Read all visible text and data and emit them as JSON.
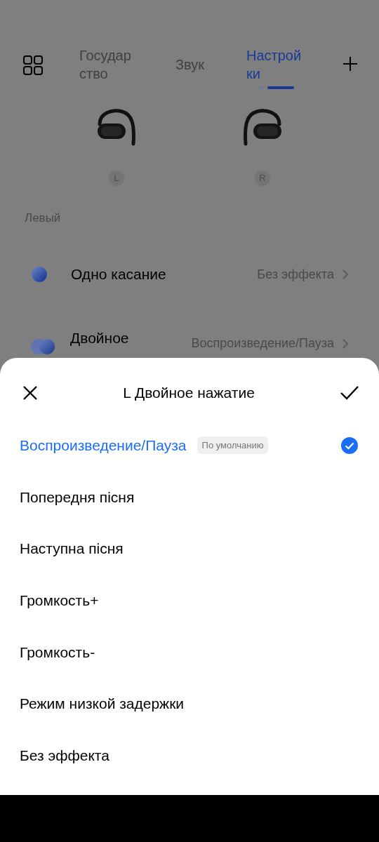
{
  "header": {
    "tabs": [
      {
        "label": "Государ\nство",
        "selected": false
      },
      {
        "label": "Звук",
        "selected": false
      },
      {
        "label": "Настрой\nки",
        "selected": true
      }
    ]
  },
  "earbuds": [
    {
      "side": "L"
    },
    {
      "side": "R"
    }
  ],
  "section_title": "Левый",
  "gestures": [
    {
      "kind": "single",
      "label": "Одно касание",
      "value": "Без эффекта"
    },
    {
      "kind": "double",
      "label": "Двойное",
      "value": "Воспроизведение/Пауза"
    }
  ],
  "sheet": {
    "title": "L Двойное нажатие",
    "options": [
      {
        "label": "Воспроизведение/Пауза",
        "selected": true,
        "badge": "По умолчанию"
      },
      {
        "label": "Попередня пісня",
        "selected": false
      },
      {
        "label": "Наступна пісня",
        "selected": false
      },
      {
        "label": "Громкость+",
        "selected": false
      },
      {
        "label": "Громкость-",
        "selected": false
      },
      {
        "label": "Режим низкой задержки",
        "selected": false
      },
      {
        "label": "Без эффекта",
        "selected": false
      }
    ]
  }
}
